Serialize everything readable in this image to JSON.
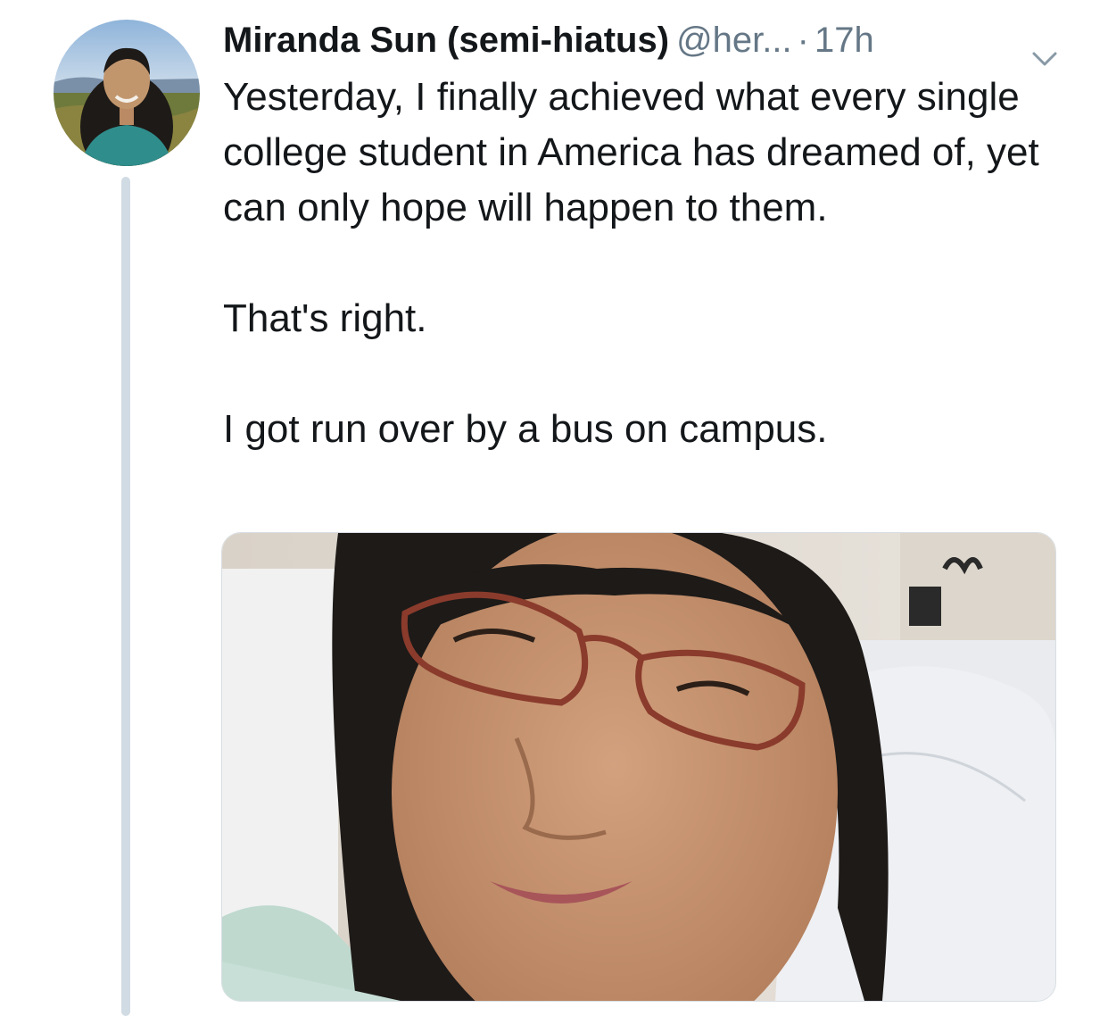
{
  "tweet": {
    "author_name": "Miranda Sun (semi-hiatus)",
    "handle": "@her...",
    "separator": "·",
    "time": "17h",
    "paragraphs": [
      "Yesterday, I finally achieved what every single college student in America has dreamed of, yet can only hope will happen to them.",
      "That's right.",
      "I got run over by a bus on campus."
    ]
  },
  "colors": {
    "text": "#14171a",
    "secondary": "#657786",
    "thread_line": "#d1dbe4"
  },
  "icons": {
    "more": "chevron-down-icon"
  }
}
